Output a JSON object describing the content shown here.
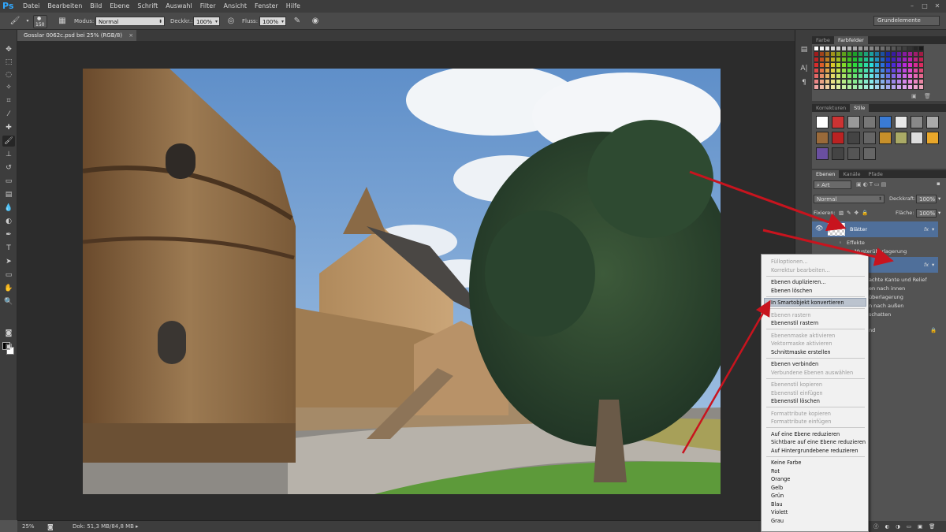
{
  "app": {
    "logo": "Ps"
  },
  "menu": [
    "Datei",
    "Bearbeiten",
    "Bild",
    "Ebene",
    "Schrift",
    "Auswahl",
    "Filter",
    "Ansicht",
    "Fenster",
    "Hilfe"
  ],
  "options": {
    "brush_size": "150",
    "mode_label": "Modus:",
    "mode_value": "Normal",
    "opacity_label": "Deckkr.:",
    "opacity_value": "100%",
    "flow_label": "Fluss:",
    "flow_value": "100%",
    "workspace": "Grundelemente"
  },
  "document": {
    "tab_title": "Gosslar 0062c.psd bei 25% (RGB/8)",
    "close": "×"
  },
  "status": {
    "zoom": "25%",
    "doc_info": "Dok: 51,3 MB/84,8 MB"
  },
  "panels": {
    "top_tabs": [
      "Farbe",
      "Farbfelder"
    ],
    "mid_tabs": [
      "Korrekturen",
      "Stile"
    ],
    "layer_tabs": [
      "Ebenen",
      "Kanäle",
      "Pfade"
    ],
    "filter_label": "Art",
    "blend_mode": "Normal",
    "opacity_label": "Deckkraft:",
    "opacity_value": "100%",
    "lock_label": "Fixieren:",
    "fill_label": "Fläche:",
    "fill_value": "100%"
  },
  "layers": {
    "layer1_name": "Blätter",
    "layer1_fx": "fx",
    "effects": "Effekte",
    "effect1": "Musterüberlagerung",
    "layer2_fx": "fx",
    "effects_partial": [
      "achte Kante und Relief",
      "en nach innen",
      "überlagerung",
      "n nach außen",
      "schatten"
    ],
    "bg_partial": "nd"
  },
  "context_menu": [
    {
      "label": "Fülloptionen...",
      "disabled": true
    },
    {
      "label": "Korrektur bearbeiten...",
      "disabled": true
    },
    {
      "label": "Ebenen duplizieren...",
      "disabled": false
    },
    {
      "label": "Ebenen löschen",
      "disabled": false
    },
    {
      "label": "In Smartobjekt konvertieren",
      "disabled": false,
      "highlighted": true
    },
    {
      "label": "Ebenen rastern",
      "disabled": true
    },
    {
      "label": "Ebenenstil rastern",
      "disabled": false
    },
    {
      "label": "Ebenenmaske aktivieren",
      "disabled": true
    },
    {
      "label": "Vektormaske aktivieren",
      "disabled": true
    },
    {
      "label": "Schnittmaske erstellen",
      "disabled": false
    },
    {
      "label": "Ebenen verbinden",
      "disabled": false
    },
    {
      "label": "Verbundene Ebenen auswählen",
      "disabled": true
    },
    {
      "label": "Ebenenstil kopieren",
      "disabled": true
    },
    {
      "label": "Ebenenstil einfügen",
      "disabled": true
    },
    {
      "label": "Ebenenstil löschen",
      "disabled": false
    },
    {
      "label": "Formattribute kopieren",
      "disabled": true
    },
    {
      "label": "Formattribute einfügen",
      "disabled": true
    },
    {
      "label": "Auf eine Ebene reduzieren",
      "disabled": false
    },
    {
      "label": "Sichtbare auf eine Ebene reduzieren",
      "disabled": false
    },
    {
      "label": "Auf Hintergrundebene reduzieren",
      "disabled": false
    },
    {
      "label": "Keine Farbe",
      "disabled": false
    },
    {
      "label": "Rot",
      "disabled": false
    },
    {
      "label": "Orange",
      "disabled": false
    },
    {
      "label": "Gelb",
      "disabled": false
    },
    {
      "label": "Grün",
      "disabled": false
    },
    {
      "label": "Blau",
      "disabled": false
    },
    {
      "label": "Violett",
      "disabled": false
    },
    {
      "label": "Grau",
      "disabled": false
    }
  ],
  "colors": {
    "annotation_arrow": "#c8141e",
    "selection_blue": "#4f6f9a"
  }
}
